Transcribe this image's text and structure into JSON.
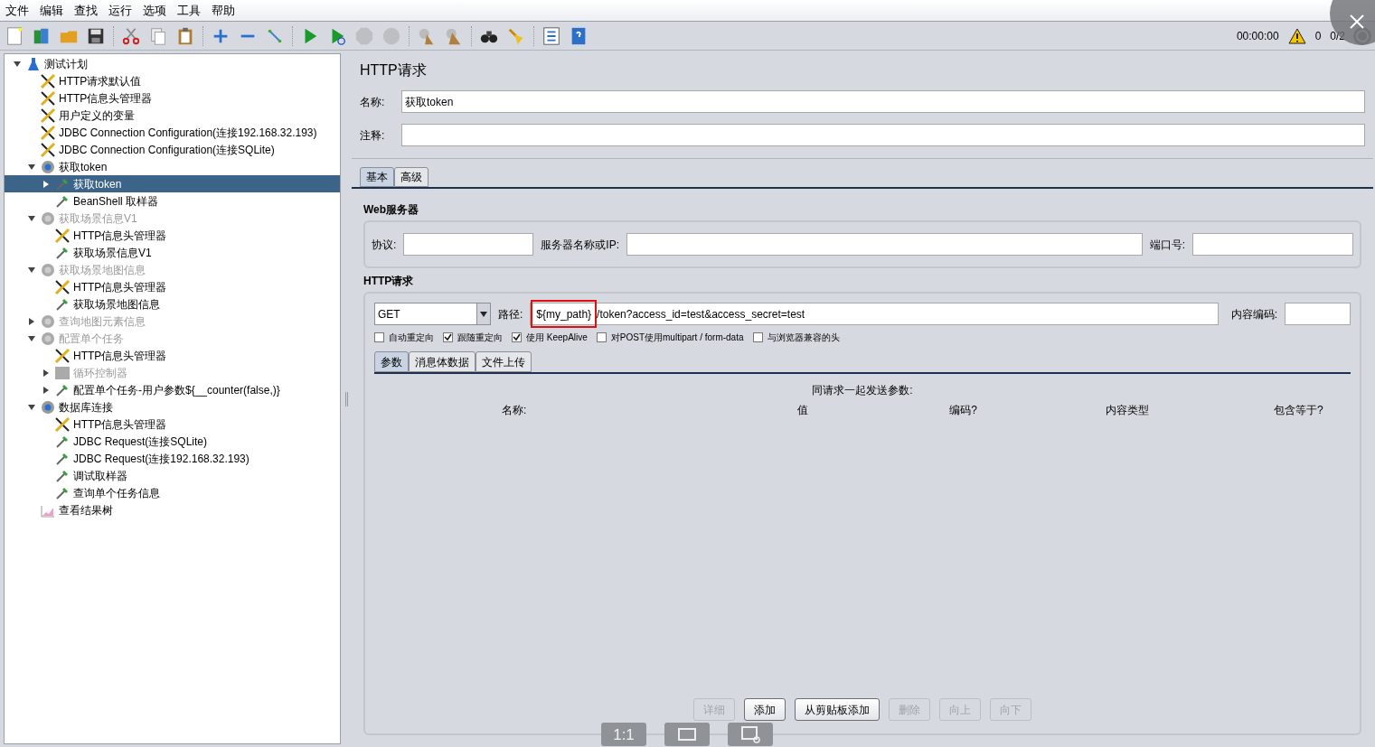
{
  "menu": [
    "文件",
    "编辑",
    "查找",
    "运行",
    "选项",
    "工具",
    "帮助"
  ],
  "toolbar": [
    {
      "kind": "new",
      "disabled": false
    },
    {
      "kind": "templates",
      "disabled": false
    },
    {
      "kind": "open",
      "disabled": false
    },
    {
      "kind": "save",
      "disabled": false
    },
    {
      "kind": "sep"
    },
    {
      "kind": "cut",
      "disabled": false
    },
    {
      "kind": "copy",
      "disabled": false
    },
    {
      "kind": "paste",
      "disabled": false
    },
    {
      "kind": "sep"
    },
    {
      "kind": "expand",
      "disabled": false
    },
    {
      "kind": "collapse",
      "disabled": false
    },
    {
      "kind": "toggle",
      "disabled": false
    },
    {
      "kind": "sep"
    },
    {
      "kind": "start",
      "disabled": false
    },
    {
      "kind": "start-no-pause",
      "disabled": false
    },
    {
      "kind": "stop",
      "disabled": true
    },
    {
      "kind": "shutdown",
      "disabled": true
    },
    {
      "kind": "sep"
    },
    {
      "kind": "clear",
      "disabled": false
    },
    {
      "kind": "clear-all",
      "disabled": false
    },
    {
      "kind": "sep"
    },
    {
      "kind": "search",
      "disabled": false
    },
    {
      "kind": "reset-search",
      "disabled": false
    },
    {
      "kind": "sep"
    },
    {
      "kind": "function",
      "disabled": false
    },
    {
      "kind": "help",
      "disabled": false
    }
  ],
  "status": {
    "timer": "00:00:00",
    "warnings": "0",
    "threads": "0/2"
  },
  "tree": [
    {
      "label": "测试计划",
      "kind": "plan",
      "expanded": true,
      "disabled": false,
      "selected": false,
      "children": [
        {
          "label": "HTTP请求默认值",
          "kind": "config",
          "disabled": false,
          "selected": false
        },
        {
          "label": "HTTP信息头管理器",
          "kind": "config",
          "disabled": false,
          "selected": false
        },
        {
          "label": "用户定义的变量",
          "kind": "config",
          "disabled": false,
          "selected": false
        },
        {
          "label": "JDBC Connection Configuration(连接192.168.32.193)",
          "kind": "config",
          "disabled": false,
          "selected": false
        },
        {
          "label": "JDBC Connection Configuration(连接SQLite)",
          "kind": "config",
          "disabled": false,
          "selected": false
        },
        {
          "label": "获取token",
          "kind": "group",
          "expanded": true,
          "disabled": false,
          "selected": false,
          "children": [
            {
              "label": "获取token",
              "kind": "sampler",
              "expanded": false,
              "disabled": false,
              "selected": true
            },
            {
              "label": "BeanShell 取样器",
              "kind": "sampler",
              "disabled": false,
              "selected": false
            }
          ]
        },
        {
          "label": "获取场景信息V1",
          "kind": "group",
          "expanded": true,
          "disabled": true,
          "selected": false,
          "children": [
            {
              "label": "HTTP信息头管理器",
              "kind": "config",
              "disabled": false,
              "selected": false
            },
            {
              "label": "获取场景信息V1",
              "kind": "sampler",
              "disabled": false,
              "selected": false
            }
          ]
        },
        {
          "label": "获取场景地图信息",
          "kind": "group",
          "expanded": true,
          "disabled": true,
          "selected": false,
          "children": [
            {
              "label": "HTTP信息头管理器",
              "kind": "config",
              "disabled": false,
              "selected": false
            },
            {
              "label": "获取场景地图信息",
              "kind": "sampler",
              "disabled": false,
              "selected": false
            }
          ]
        },
        {
          "label": "查询地图元素信息",
          "kind": "group",
          "expanded": false,
          "disabled": true,
          "selected": false
        },
        {
          "label": "配置单个任务",
          "kind": "group",
          "expanded": true,
          "disabled": true,
          "selected": false,
          "children": [
            {
              "label": "HTTP信息头管理器",
              "kind": "config",
              "disabled": false,
              "selected": false
            },
            {
              "label": "循环控制器",
              "kind": "loop",
              "expanded": false,
              "disabled": true,
              "selected": false
            },
            {
              "label": "配置单个任务-用户参数${__counter(false,)}",
              "kind": "sampler",
              "expanded": false,
              "disabled": false,
              "selected": false
            }
          ]
        },
        {
          "label": "数据库连接",
          "kind": "group",
          "expanded": true,
          "disabled": false,
          "selected": false,
          "children": [
            {
              "label": "HTTP信息头管理器",
              "kind": "config",
              "disabled": false,
              "selected": false
            },
            {
              "label": "JDBC Request(连接SQLite)",
              "kind": "sampler",
              "disabled": false,
              "selected": false
            },
            {
              "label": "JDBC Request(连接192.168.32.193)",
              "kind": "sampler",
              "disabled": false,
              "selected": false
            },
            {
              "label": "调试取样器",
              "kind": "sampler",
              "disabled": false,
              "selected": false
            },
            {
              "label": "查询单个任务信息",
              "kind": "sampler",
              "disabled": false,
              "selected": false
            }
          ]
        },
        {
          "label": "查看结果树",
          "kind": "listener",
          "disabled": false,
          "selected": false
        }
      ]
    }
  ],
  "panel": {
    "title": "HTTP请求",
    "name_label": "名称:",
    "name_value": "获取token",
    "comment_label": "注释:"
  },
  "tabs": [
    {
      "label": "基本",
      "selected": true
    },
    {
      "label": "高级",
      "selected": false
    }
  ],
  "web_server": {
    "title": "Web服务器",
    "protocol_label": "协议:",
    "server_label": "服务器名称或IP:",
    "port_label": "端口号:"
  },
  "http_request": {
    "title": "HTTP请求",
    "method": "GET",
    "path_label": "路径:",
    "path_highlight": "${my_path}",
    "path_rest": "/token?access_id=test&access_secret=test",
    "encoding_label": "内容编码:"
  },
  "options": [
    {
      "label": "自动重定向",
      "checked": false
    },
    {
      "label": "跟随重定向",
      "checked": true
    },
    {
      "label": "使用 KeepAlive",
      "checked": true
    },
    {
      "label": "对POST使用multipart / form-data",
      "checked": false
    },
    {
      "label": "与浏览器兼容的头",
      "checked": false
    }
  ],
  "sub_tabs": [
    {
      "label": "参数",
      "selected": true
    },
    {
      "label": "消息体数据",
      "selected": false
    },
    {
      "label": "文件上传",
      "selected": false
    }
  ],
  "params": {
    "title": "同请求一起发送参数:",
    "columns": [
      "名称:",
      "值",
      "编码?",
      "内容类型",
      "包含等于?"
    ]
  },
  "buttons": [
    {
      "label": "详细",
      "disabled": true
    },
    {
      "label": "添加",
      "disabled": false
    },
    {
      "label": "从剪贴板添加",
      "disabled": false
    },
    {
      "label": "删除",
      "disabled": true
    },
    {
      "label": "向上",
      "disabled": true
    },
    {
      "label": "向下",
      "disabled": true
    }
  ],
  "viewer": {
    "actual_size": "1:1"
  }
}
